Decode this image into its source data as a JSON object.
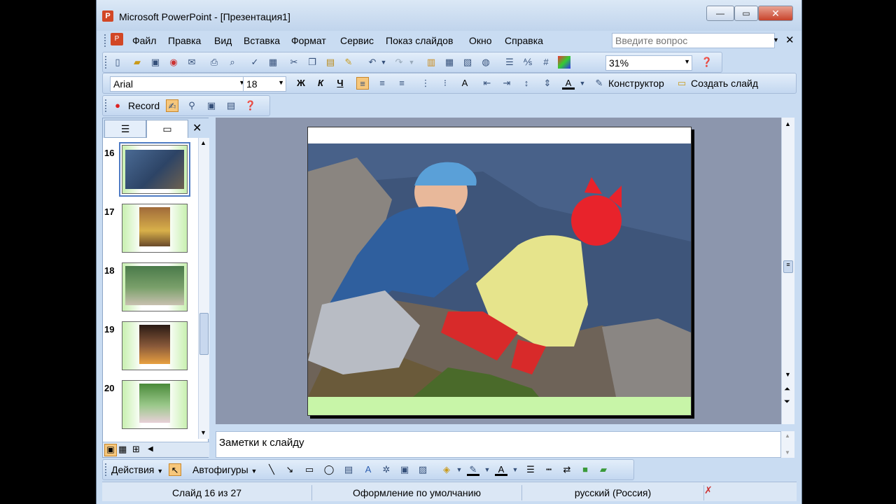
{
  "window": {
    "title": "Microsoft PowerPoint - [Презентация1]",
    "minimize": "—",
    "maximize": "▭",
    "close": "✕"
  },
  "menu": {
    "items": [
      "Файл",
      "Правка",
      "Вид",
      "Вставка",
      "Формат",
      "Сервис",
      "Показ слайдов",
      "Окно",
      "Справка"
    ],
    "help_placeholder": "Введите вопрос"
  },
  "standard_toolbar": {
    "zoom": "31%"
  },
  "format_toolbar": {
    "font_name": "Arial",
    "font_size": "18",
    "bold": "Ж",
    "italic": "К",
    "underline": "Ч",
    "designer_label": "Конструктор",
    "new_slide_label": "Создать слайд"
  },
  "record_toolbar": {
    "record_label": "Record"
  },
  "slide_panel": {
    "thumbnails": [
      {
        "number": "16",
        "selected": true
      },
      {
        "number": "17",
        "selected": false
      },
      {
        "number": "18",
        "selected": false
      },
      {
        "number": "19",
        "selected": false
      },
      {
        "number": "20",
        "selected": false
      }
    ]
  },
  "notes": {
    "placeholder": "Заметки к слайду"
  },
  "drawing_toolbar": {
    "actions_label": "Действия",
    "autoshapes_label": "Автофигуры"
  },
  "status": {
    "slide_info": "Слайд 16 из 27",
    "design": "Оформление по умолчанию",
    "language": "русский (Россия)"
  },
  "colors": {
    "slide_footer": "#c8f5a8",
    "window_bg": "#c9dcf2",
    "selection": "#4f7bc4"
  }
}
